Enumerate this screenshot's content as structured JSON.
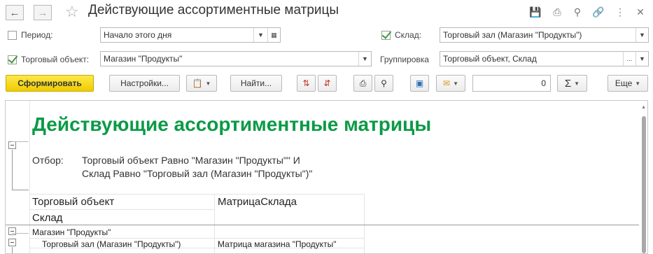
{
  "window": {
    "title": "Действующие ассортиментные матрицы"
  },
  "filters": {
    "period_label": "Период:",
    "period_value": "Начало этого дня",
    "trade_object_label": "Торговый объект:",
    "trade_object_value": "Магазин \"Продукты\"",
    "warehouse_label": "Склад:",
    "warehouse_value": "Торговый зал (Магазин \"Продукты\")",
    "grouping_label": "Группировка",
    "grouping_value": "Торговый объект, Склад",
    "ellipsis": "...",
    "period_checked": false,
    "trade_object_checked": true,
    "warehouse_checked": true
  },
  "toolbar": {
    "generate_label": "Сформировать",
    "settings_label": "Настройки...",
    "find_label": "Найти...",
    "sum_value": "0",
    "more_label": "Еще"
  },
  "report": {
    "title": "Действующие ассортиментные матрицы",
    "filter_label": "Отбор:",
    "filter_line1": "Торговый объект Равно \"Магазин \"Продукты\"\" И",
    "filter_line2": "Склад Равно \"Торговый зал (Магазин \"Продукты\")\"",
    "col_trade_object": "Торговый объект",
    "col_matrix": "МатрицаСклада",
    "col_warehouse": "Склад",
    "group_row": "Магазин \"Продукты\"",
    "detail_row_warehouse": "Торговый зал (Магазин \"Продукты\")",
    "detail_row_matrix": "Матрица магазина \"Продукты\""
  },
  "colors": {
    "accent_yellow": "#f0cc00",
    "title_green": "#0b9a46",
    "check_green": "#3a9d3a"
  }
}
